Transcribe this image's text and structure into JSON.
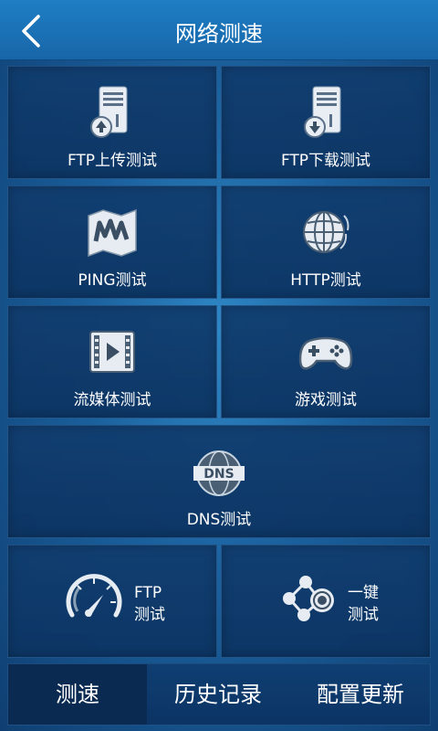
{
  "header": {
    "title": "网络测速",
    "back_icon": "chevron-left-icon"
  },
  "tiles": [
    {
      "label": "FTP上传测试",
      "icon": "server-upload-icon"
    },
    {
      "label": "FTP下载测试",
      "icon": "server-download-icon"
    },
    {
      "label": "PING测试",
      "icon": "map-icon"
    },
    {
      "label": "HTTP测试",
      "icon": "globe-icon"
    },
    {
      "label": "流媒体测试",
      "icon": "video-play-icon"
    },
    {
      "label": "游戏测试",
      "icon": "gamepad-icon"
    },
    {
      "label": "DNS测试",
      "icon": "dns-globe-icon"
    }
  ],
  "ftp_test": {
    "line1": "FTP",
    "line2": "测试",
    "icon": "speedometer-icon"
  },
  "one_click_test": {
    "line1": "一键",
    "line2": "测试",
    "icon": "share-network-icon"
  },
  "tabs": [
    {
      "label": "测速",
      "active": true
    },
    {
      "label": "历史记录",
      "active": false
    },
    {
      "label": "配置更新",
      "active": false
    }
  ],
  "colors": {
    "accent": "#1a6fb4",
    "tile": "#0f3c6e",
    "active_tab": "#0a2a52"
  }
}
